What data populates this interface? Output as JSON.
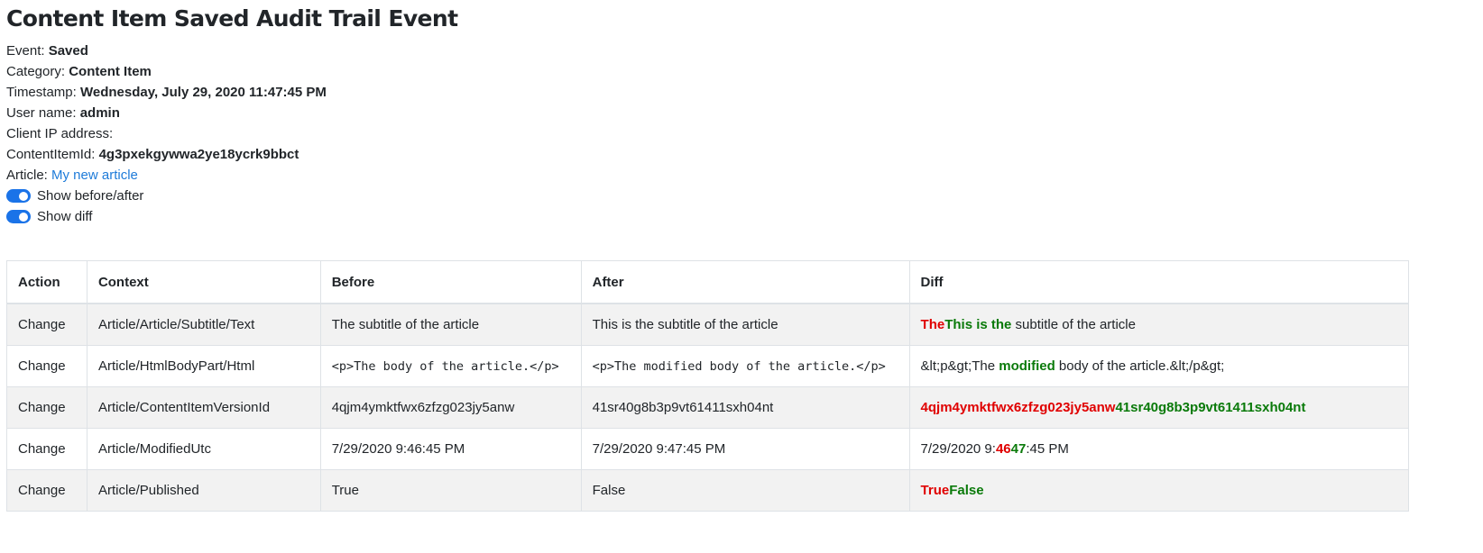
{
  "title": "Content Item Saved Audit Trail Event",
  "meta": {
    "event": {
      "label": "Event:",
      "value": "Saved"
    },
    "category": {
      "label": "Category:",
      "value": "Content Item"
    },
    "timestamp": {
      "label": "Timestamp:",
      "value": "Wednesday, July 29, 2020 11:47:45 PM"
    },
    "user": {
      "label": "User name:",
      "value": "admin"
    },
    "ip": {
      "label": "Client IP address:",
      "value": ""
    },
    "content_item_id": {
      "label": "ContentItemId:",
      "value": "4g3pxekgywwa2ye18ycrk9bbct"
    },
    "article": {
      "label": "Article:",
      "link": "My new article"
    }
  },
  "toggles": {
    "before_after": {
      "label": "Show before/after",
      "checked": true
    },
    "diff": {
      "label": "Show diff",
      "checked": true
    }
  },
  "colors": {
    "switch_on": "#1a73e8",
    "link": "#1e7bd9",
    "diff_removed": "#e00000",
    "diff_added": "#0a7a0a",
    "row_stripe": "#f2f2f2"
  },
  "table": {
    "headers": {
      "action": "Action",
      "context": "Context",
      "before": "Before",
      "after": "After",
      "diff": "Diff"
    },
    "rows": [
      {
        "action": "Change",
        "context": "Article/Article/Subtitle/Text",
        "before": "The subtitle of the article",
        "after": "This is the subtitle of the article",
        "diff": {
          "del": "The",
          "ins": "This is the",
          "rest": " subtitle of the article"
        }
      },
      {
        "action": "Change",
        "context": "Article/HtmlBodyPart/Html",
        "before": "<p>The body of the article.</p>",
        "after": "<p>The modified body of the article.</p>",
        "diff": {
          "pre": "&lt;p&gt;The ",
          "ins": "modified",
          "post": " body of the article.&lt;/p&gt;"
        }
      },
      {
        "action": "Change",
        "context": "Article/ContentItemVersionId",
        "before": "4qjm4ymktfwx6zfzg023jy5anw",
        "after": "41sr40g8b3p9vt61411sxh04nt",
        "diff": {
          "del": "4qjm4ymktfwx6zfzg023jy5anw",
          "ins": "41sr40g8b3p9vt61411sxh04nt"
        }
      },
      {
        "action": "Change",
        "context": "Article/ModifiedUtc",
        "before": "7/29/2020 9:46:45 PM",
        "after": "7/29/2020 9:47:45 PM",
        "diff": {
          "pre": "7/29/2020 9:",
          "del": "46",
          "ins": "47",
          "post": ":45 PM"
        }
      },
      {
        "action": "Change",
        "context": "Article/Published",
        "before": "True",
        "after": "False",
        "diff": {
          "del": "True",
          "ins": "False"
        }
      }
    ]
  }
}
